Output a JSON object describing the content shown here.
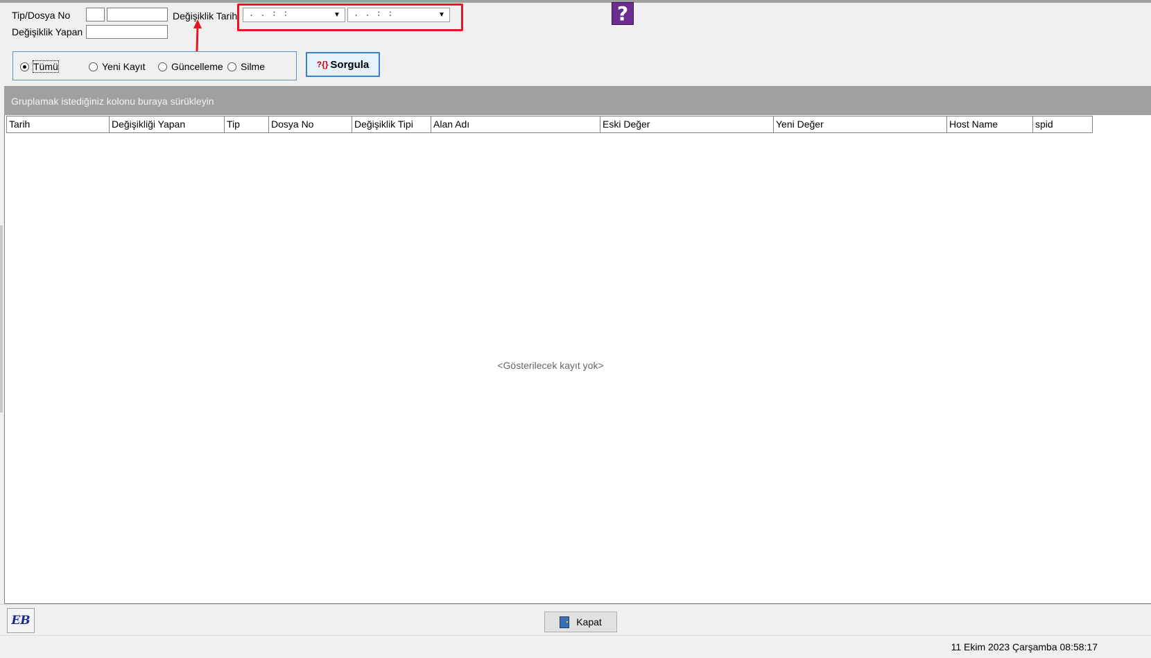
{
  "filters": {
    "tip_dosya_label": "Tip/Dosya No",
    "degisiklik_yapan_label": "Değişiklik Yapan",
    "degisiklik_tarih_label": "Değişiklik Tarih",
    "tip_value": "",
    "dosya_value": "",
    "yapan_value": "",
    "date_start_mask": ". .   : :",
    "date_end_mask": ". .   : :"
  },
  "radio": {
    "options": [
      {
        "label": "Tümü",
        "selected": true
      },
      {
        "label": "Yeni Kayıt",
        "selected": false
      },
      {
        "label": "Güncelleme",
        "selected": false
      },
      {
        "label": "Silme",
        "selected": false
      }
    ]
  },
  "buttons": {
    "sorgula": "Sorgula",
    "kapat": "Kapat",
    "eb": "EB",
    "help": "?"
  },
  "grid": {
    "group_hint": "Gruplamak istediğiniz kolonu buraya sürükleyin",
    "columns": [
      "Tarih",
      "Değişikliği Yapan",
      "Tip",
      "Dosya No",
      "Değişiklik Tipi",
      "Alan Adı",
      "Eski Değer",
      "Yeni Değer",
      "Host Name",
      "spid"
    ],
    "empty_text": "<Gösterilecek kayıt yok>"
  },
  "status": {
    "datetime": "11 Ekim 2023 Çarşamba 08:58:17"
  },
  "colors": {
    "highlight": "#e8141f",
    "accent": "#3b7fd0",
    "group_bar": "#a0a0a0"
  }
}
